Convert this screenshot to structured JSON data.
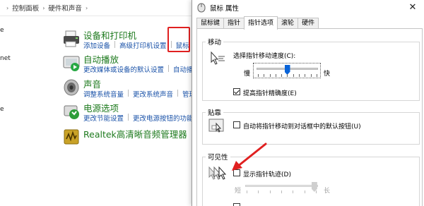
{
  "control_panel": {
    "breadcrumb": [
      "控制面板",
      "硬件和声音"
    ],
    "left_fragments": [
      "e",
      "net",
      "e"
    ],
    "categories": [
      {
        "title": "设备和打印机",
        "links": [
          "添加设备",
          "高级打印机设置",
          "鼠标"
        ],
        "icon": "printer-icon"
      },
      {
        "title": "自动播放",
        "links": [
          "更改媒体或设备的默认设置",
          "自动播放"
        ],
        "icon": "autoplay-icon"
      },
      {
        "title": "声音",
        "links": [
          "调整系统音量",
          "更改系统声音",
          "管理"
        ],
        "icon": "speaker-icon"
      },
      {
        "title": "电源选项",
        "links": [
          "更改节能设置",
          "更改电源按钮的功能"
        ],
        "icon": "power-icon"
      },
      {
        "title": "Realtek高清晰音频管理器",
        "links": [],
        "icon": "realtek-icon"
      }
    ],
    "highlight_color": "#e02020",
    "title_color": "#1e7a1e",
    "link_color": "#1a52a8"
  },
  "dialog": {
    "title": "鼠标 属性",
    "close_glyph": "✕",
    "tabs": [
      "鼠标键",
      "指针",
      "指针选项",
      "滚轮",
      "硬件"
    ],
    "active_tab": "指针选项",
    "motion": {
      "label": "移动",
      "speed_label": "选择指针移动速度(C):",
      "slow": "慢",
      "fast": "快",
      "speed_level": 0.5,
      "precision_label": "提高指针精确度(E)",
      "precision_checked": true
    },
    "snap": {
      "label": "贴靠",
      "snap_label": "自动将指针移动到对话框中的默认按钮(U)",
      "snap_checked": false
    },
    "visibility": {
      "label": "可见性",
      "trails_label": "显示指针轨迹(D)",
      "trails_checked": false,
      "short": "短",
      "long": "长",
      "trail_level": 0.95
    }
  }
}
